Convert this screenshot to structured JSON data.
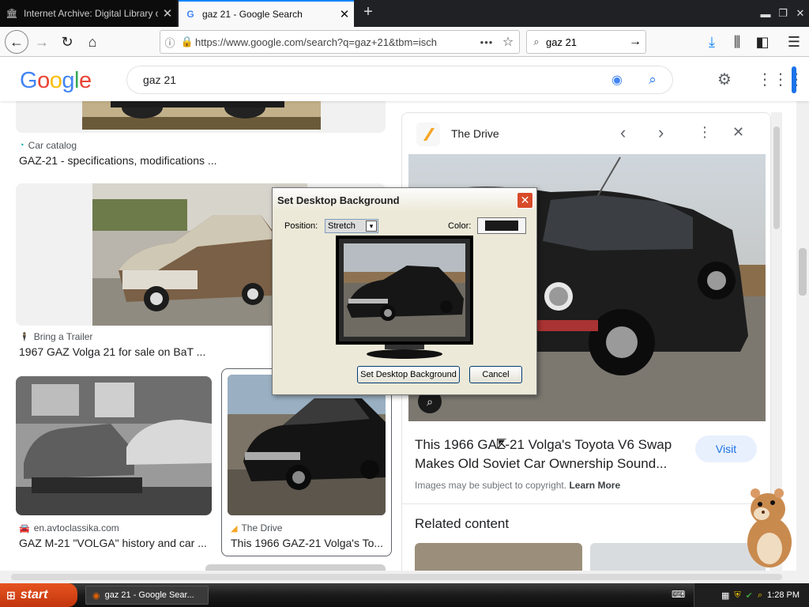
{
  "browser": {
    "tabs": [
      {
        "label": "Internet Archive: Digital Library of",
        "icon": "archive-icon"
      },
      {
        "label": "gaz 21 - Google Search",
        "icon": "google-icon"
      }
    ],
    "url": "https://www.google.com/search?q=gaz+21&tbm=isch",
    "search_value": "gaz 21"
  },
  "google": {
    "logo": "Google",
    "query": "gaz 21"
  },
  "results": [
    {
      "source": "Car catalog",
      "title": "GAZ-21 - specifications, modifications ..."
    },
    {
      "source": "Bring a Trailer",
      "title": "1967 GAZ Volga 21 for sale on BaT ..."
    },
    {
      "source": "en.avtoclassika.com",
      "title": "GAZ M-21 \"VOLGA\" history and car ..."
    },
    {
      "source": "The Drive",
      "title": "This 1966 GAZ-21 Volga's To..."
    }
  ],
  "panel": {
    "source": "The Drive",
    "title_line1": "This 1966 GAZ-21 Volga's Toyota V6 Swap",
    "title_line2": "Makes Old Soviet Car Ownership Sound...",
    "visit": "Visit",
    "copyright": "Images may be subject to copyright.",
    "learn_more": "Learn More",
    "related": "Related content"
  },
  "dialog": {
    "title": "Set Desktop Background",
    "position_label": "Position:",
    "position_value": "Stretch",
    "color_label": "Color:",
    "color_value": "#1a1a1a",
    "ok_label": "Set Desktop Background",
    "cancel_label": "Cancel"
  },
  "taskbar": {
    "start": "start",
    "item": "gaz 21 - Google Sear...",
    "time": "1:28 PM"
  }
}
